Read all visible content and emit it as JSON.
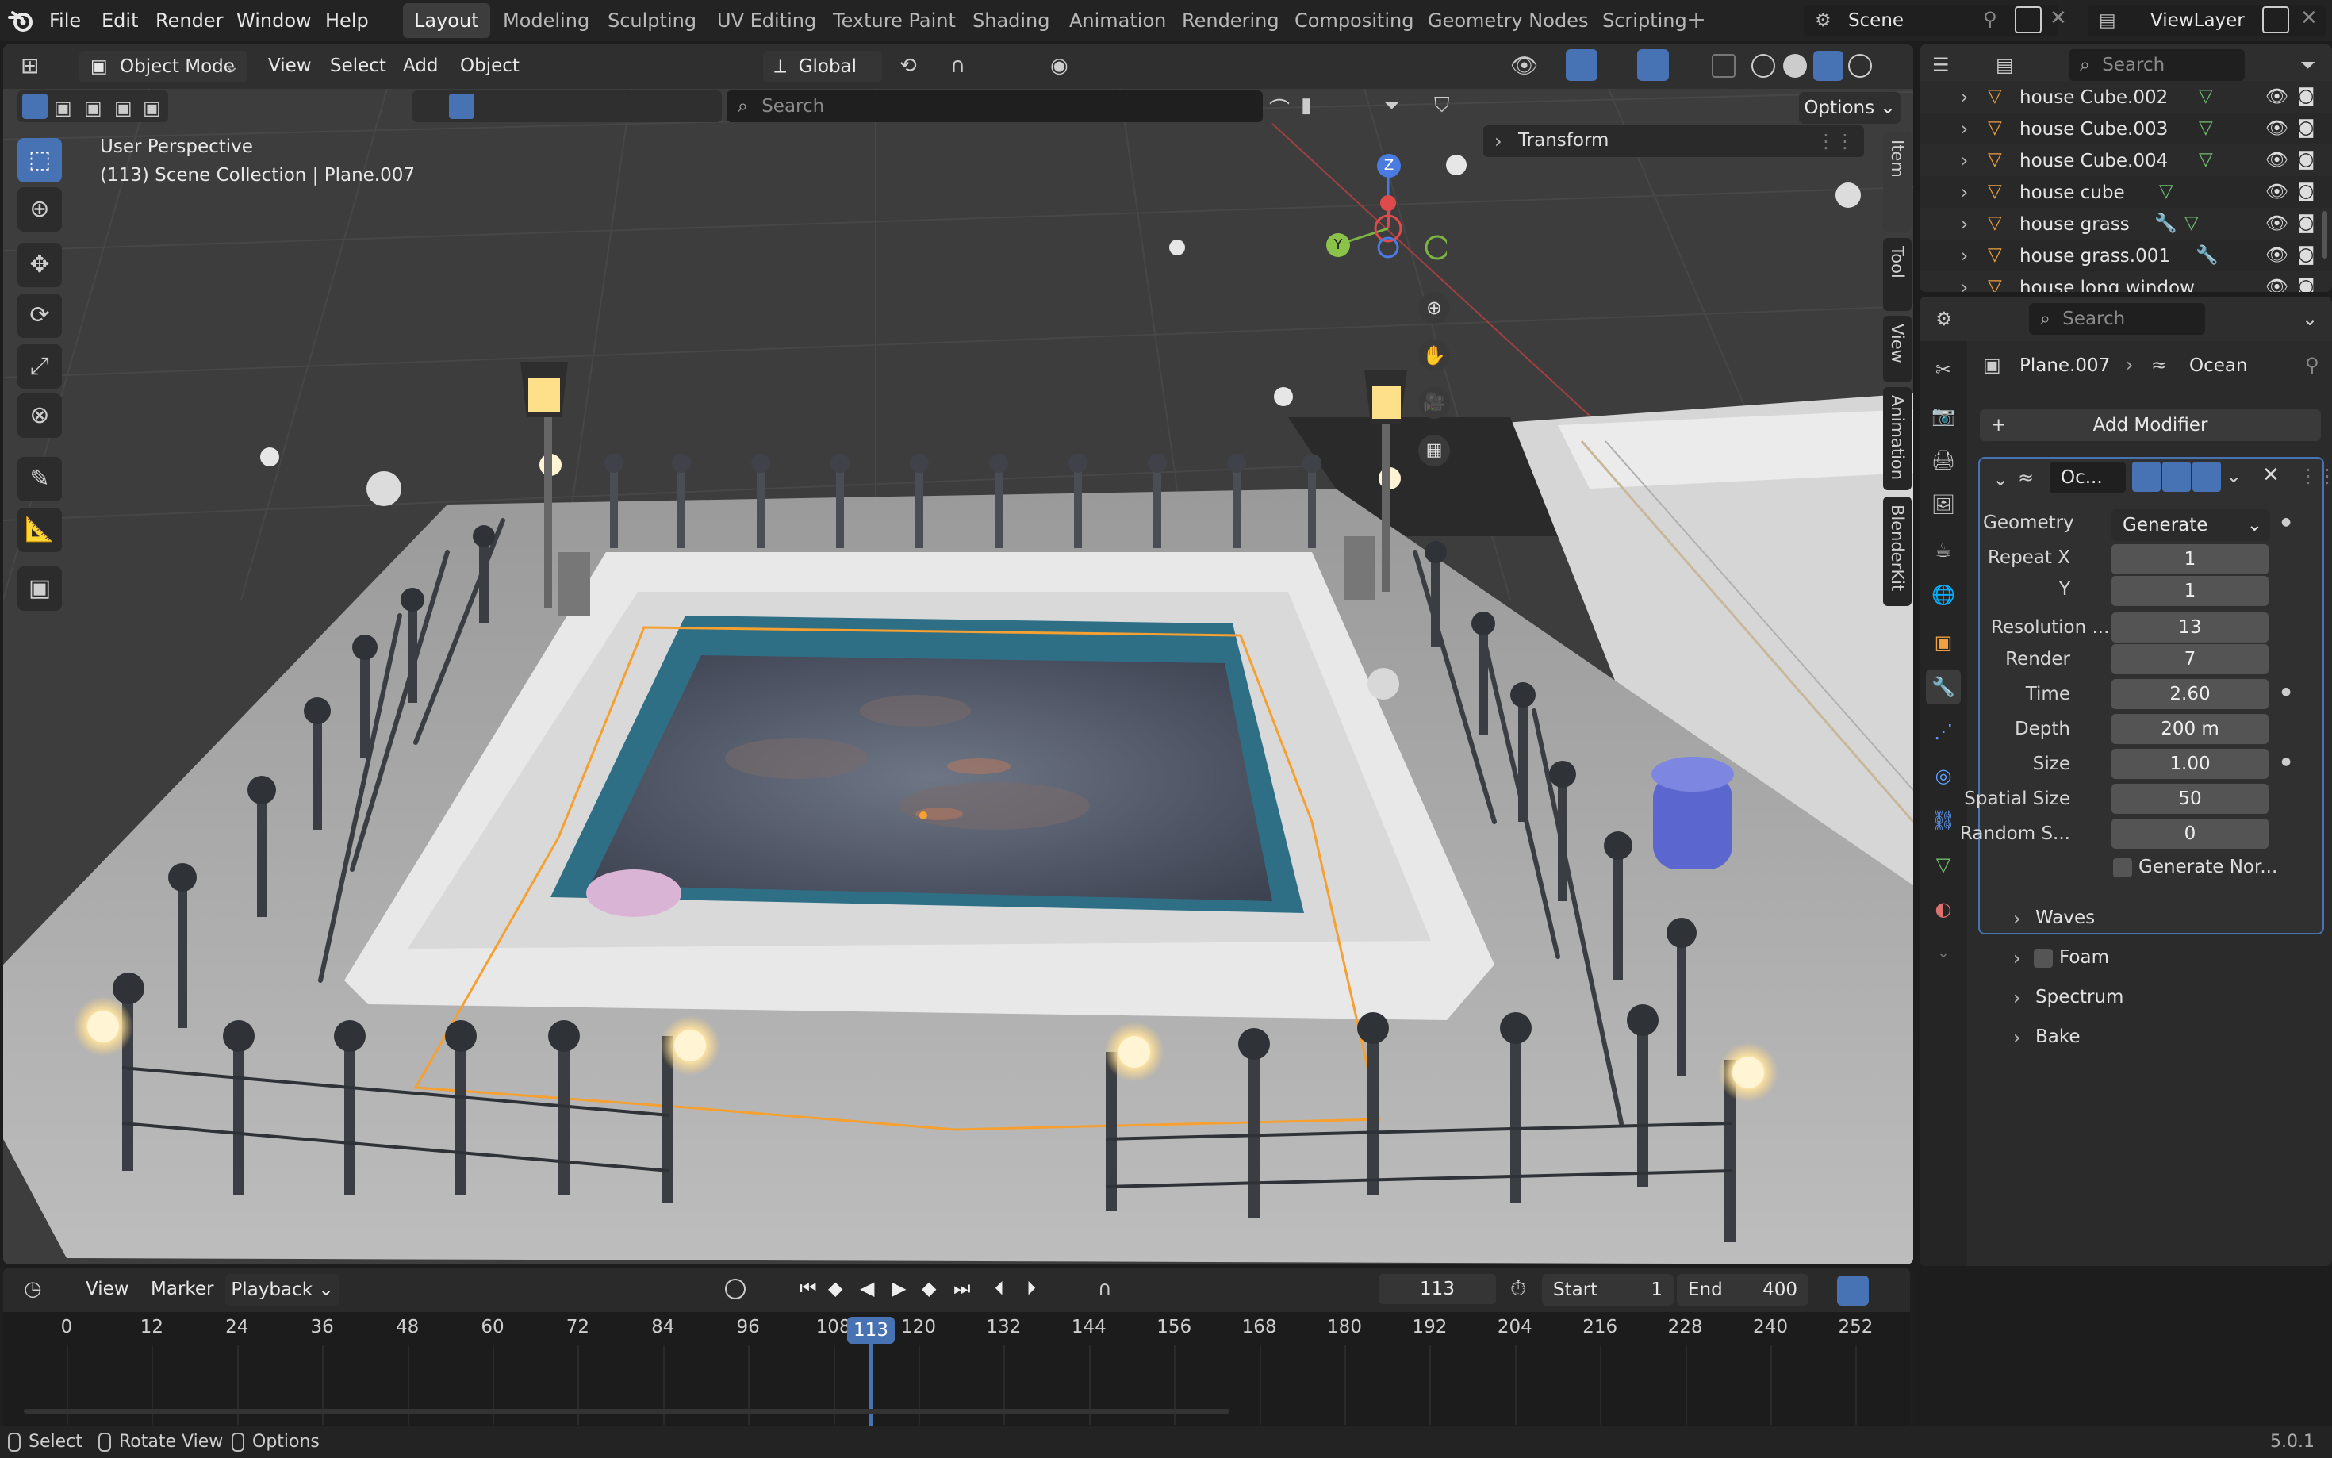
{
  "app": {
    "logo": "blender-logo-icon",
    "version": "5.0.1"
  },
  "menu": [
    "File",
    "Edit",
    "Render",
    "Window",
    "Help"
  ],
  "workspaces": [
    "Layout",
    "Modeling",
    "Sculpting",
    "UV Editing",
    "Texture Paint",
    "Shading",
    "Animation",
    "Rendering",
    "Compositing",
    "Geometry Nodes",
    "Scripting"
  ],
  "active_workspace": "Layout",
  "scene": {
    "name": "Scene",
    "view_layer": "ViewLayer"
  },
  "viewport": {
    "mode": "Object Mode",
    "menus": [
      "View",
      "Select",
      "Add",
      "Object"
    ],
    "transform_orientation": "Global",
    "search_placeholder": "Search",
    "options_label": "Options",
    "info_line1": "User Perspective",
    "info_line2": "(113) Scene Collection | Plane.007",
    "transform_panel": "Transform",
    "side_tabs": [
      "Item",
      "Tool",
      "View",
      "Animation",
      "BlenderKit"
    ],
    "gizmo": {
      "z": "Z",
      "y": "Y"
    }
  },
  "outliner": {
    "search_placeholder": "Search",
    "items": [
      {
        "name": "house Cube.002",
        "mod": "mesh-data-icon"
      },
      {
        "name": "house Cube.003",
        "mod": "mesh-data-icon"
      },
      {
        "name": "house Cube.004",
        "mod": "mesh-data-icon"
      },
      {
        "name": "house cube",
        "mod": "mesh-data-icon"
      },
      {
        "name": "house grass",
        "mod": "wrench-icon"
      },
      {
        "name": "house grass.001",
        "mod": "wrench-icon"
      },
      {
        "name": "house long window",
        "mod": "mesh-data-icon"
      }
    ]
  },
  "properties": {
    "search_placeholder": "Search",
    "breadcrumb_object": "Plane.007",
    "breadcrumb_modifier": "Ocean",
    "add_modifier": "Add Modifier",
    "modifier_name": "Oc...",
    "fields": [
      {
        "label": "Geometry",
        "value": "Generate",
        "type": "dropdown"
      },
      {
        "label": "Repeat X",
        "value": "1"
      },
      {
        "label": "Y",
        "value": "1"
      },
      {
        "label": "Resolution ...",
        "value": "13"
      },
      {
        "label": "Render",
        "value": "7"
      },
      {
        "label": "Time",
        "value": "2.60"
      },
      {
        "label": "Depth",
        "value": "200 m"
      },
      {
        "label": "Size",
        "value": "1.00"
      },
      {
        "label": "Spatial Size",
        "value": "50"
      },
      {
        "label": "Random S...",
        "value": "0"
      }
    ],
    "generate_normals": "Generate Nor...",
    "sections": [
      "Waves",
      "Foam",
      "Spectrum",
      "Bake"
    ]
  },
  "timeline": {
    "menus": [
      "View",
      "Marker",
      "Playback"
    ],
    "current_frame": "113",
    "start_label": "Start",
    "start": "1",
    "end_label": "End",
    "end": "400",
    "ticks": [
      "0",
      "12",
      "24",
      "36",
      "48",
      "60",
      "72",
      "84",
      "96",
      "108",
      "120",
      "132",
      "144",
      "156",
      "168",
      "180",
      "192",
      "204",
      "216",
      "228",
      "240",
      "252"
    ]
  },
  "statusbar": {
    "items": [
      "Select",
      "Rotate View",
      "Options"
    ]
  },
  "colors": {
    "accent": "#4772b3",
    "selection": "#f5a030",
    "bg": "#1d1d1d"
  }
}
